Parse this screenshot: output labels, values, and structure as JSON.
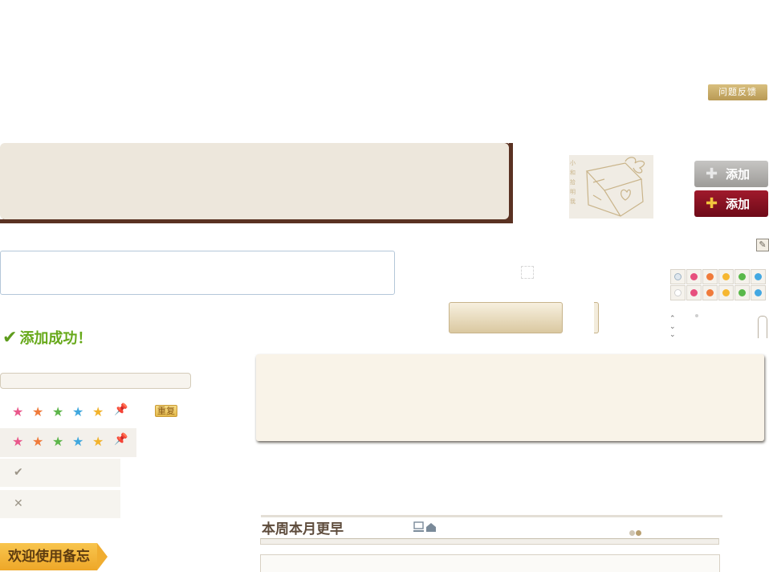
{
  "feedback": {
    "label": "问题反馈"
  },
  "buttons": {
    "add_label": "添加",
    "add_label_active": "添加"
  },
  "status": {
    "success_text": "添加成功！"
  },
  "rating": {
    "reset_label": "重复"
  },
  "options": {
    "confirm_glyph": "✔",
    "cancel_glyph": "✕"
  },
  "periods": {
    "tabs_text": "本周本月更早"
  },
  "welcome": {
    "label": "欢迎使用备忘"
  },
  "colors": {
    "brand_brown": "#5a3222",
    "success_green": "#67a91a",
    "add_red": "#8a1222",
    "swatches": [
      "#dfe7ee",
      "#e7507e",
      "#f07b3b",
      "#f6b731",
      "#59b84a",
      "#43a8e2"
    ]
  },
  "icons": {
    "add": "plus-icon",
    "edit": "pencil-icon",
    "success": "check-icon",
    "pin": "pushpin-icon",
    "gift": "gift-stamp-image"
  }
}
